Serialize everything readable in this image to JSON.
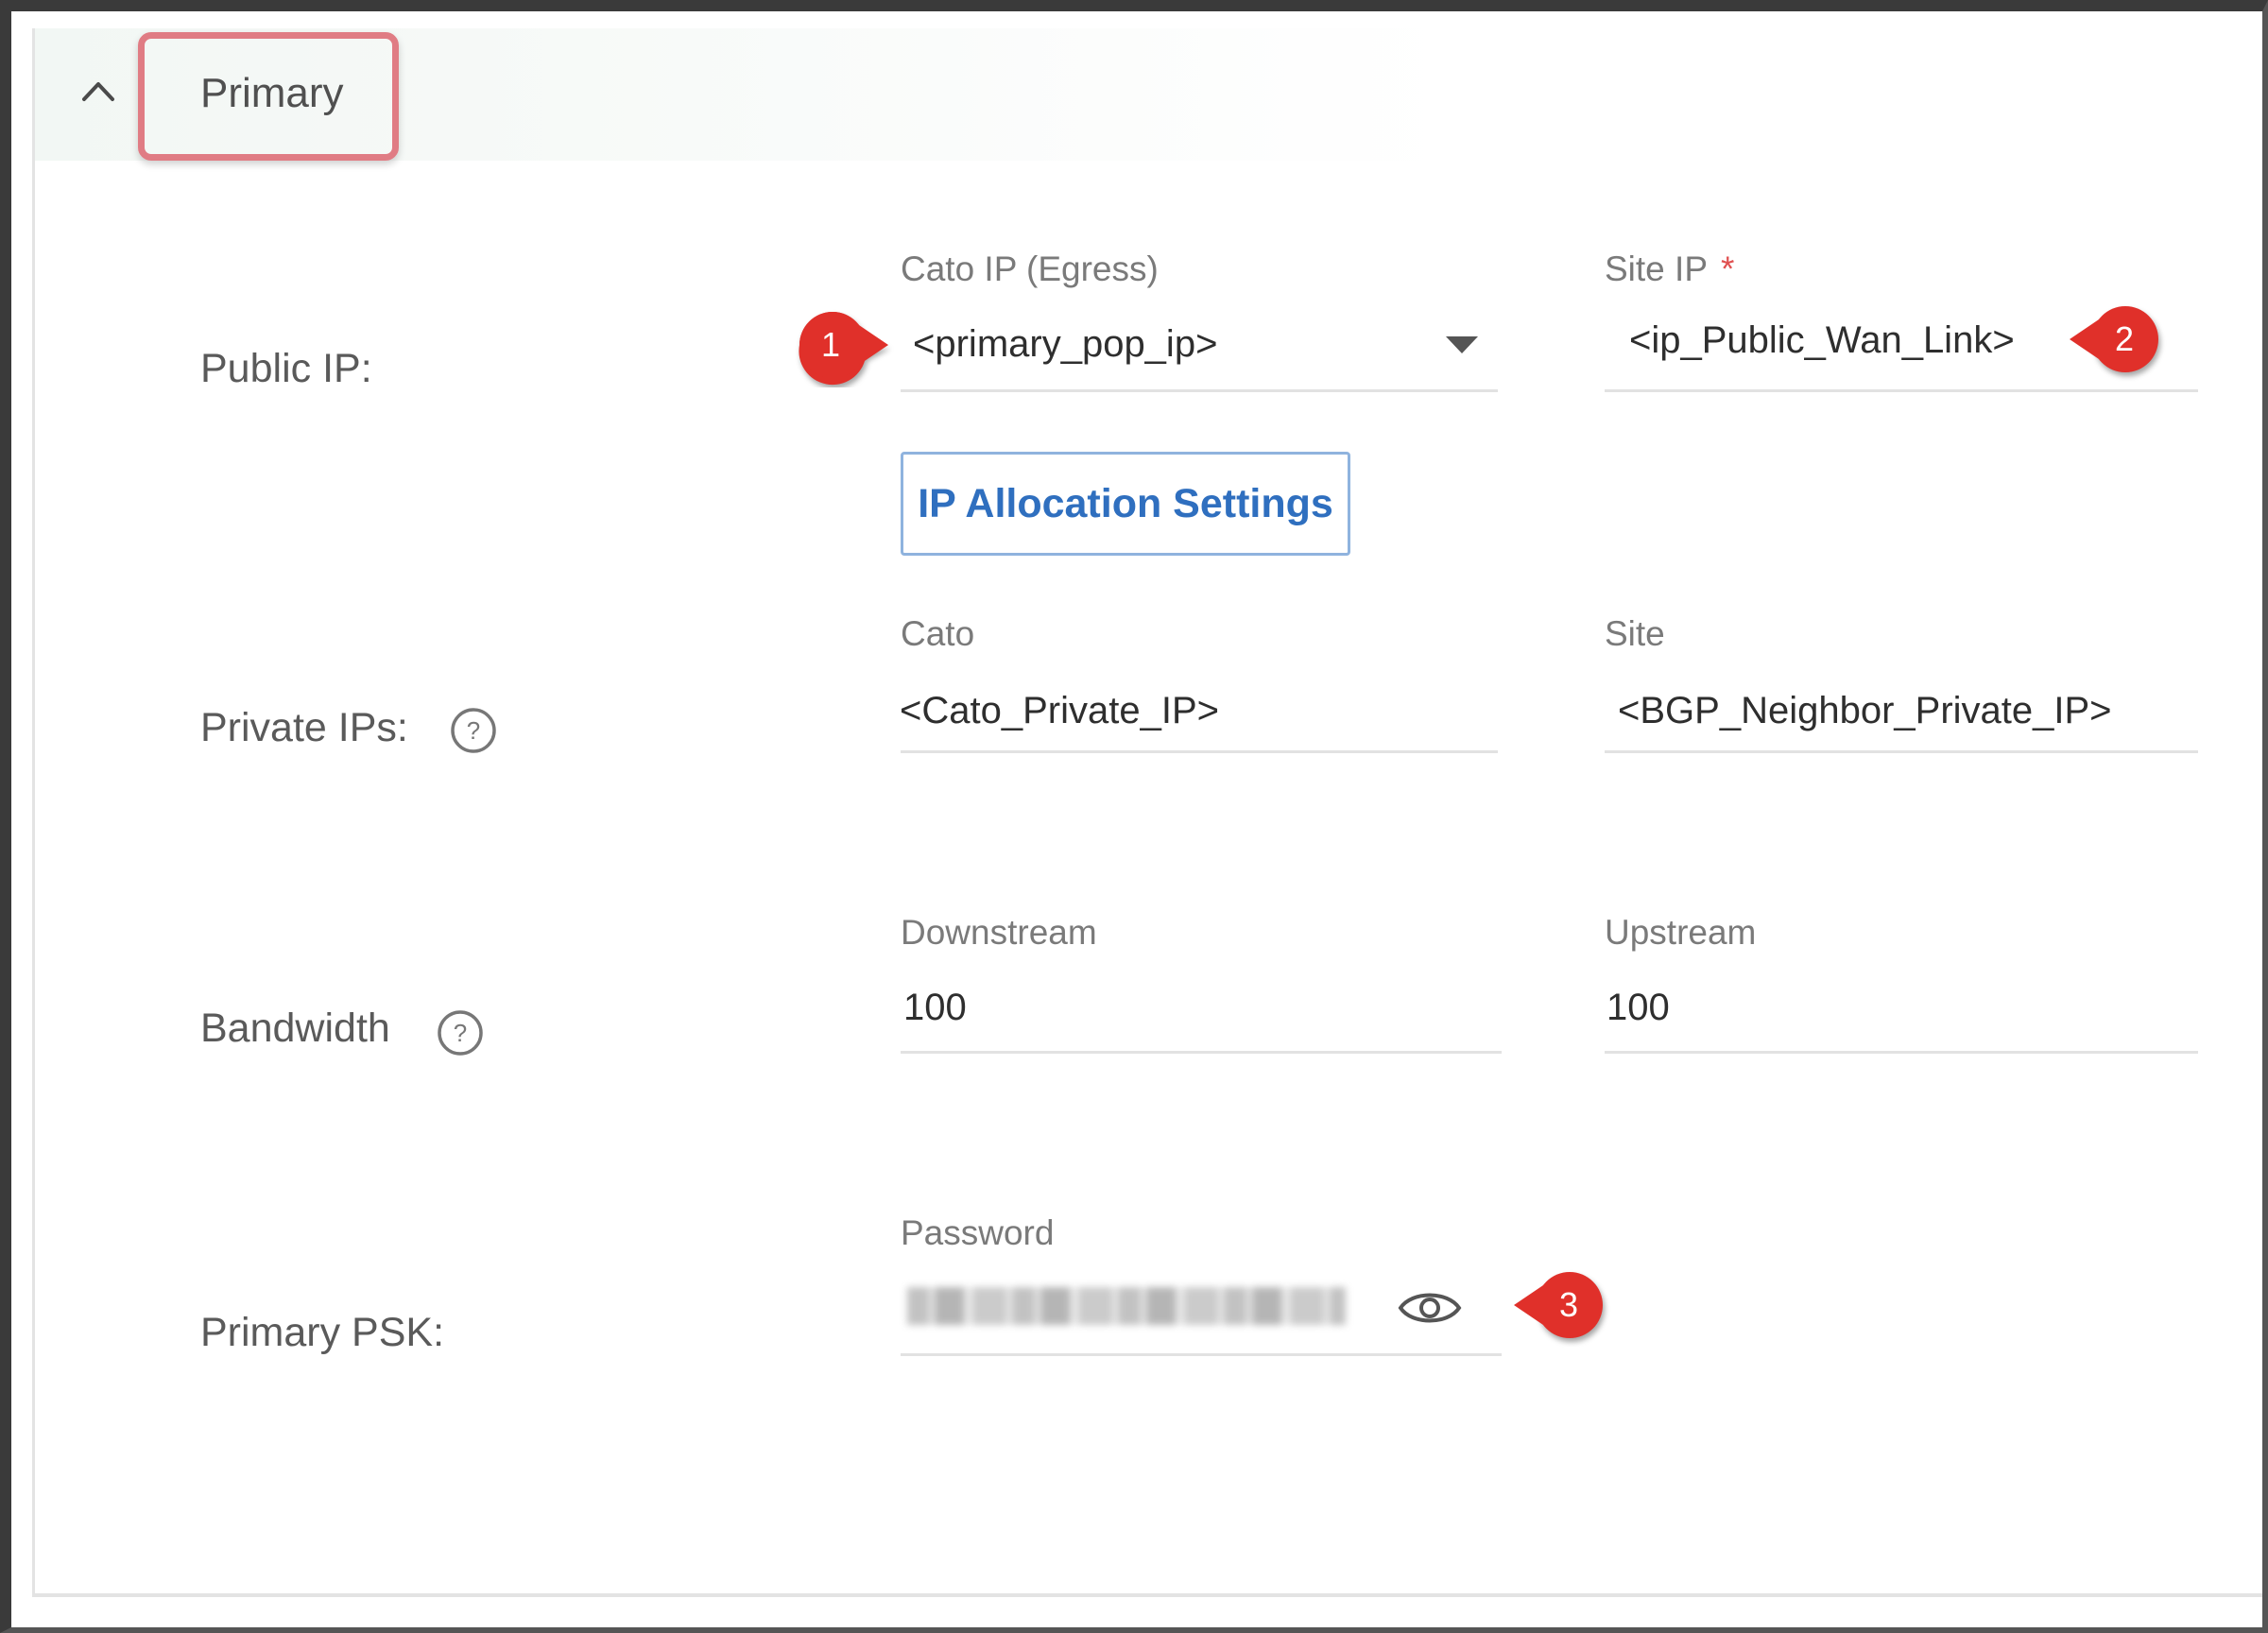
{
  "section": {
    "title": "Primary",
    "collapse_icon": "chevron-up-icon"
  },
  "public_ip": {
    "label": "Public IP:",
    "cato_ip_label": "Cato IP (Egress)",
    "cato_ip_value": "<primary_pop_ip>",
    "site_ip_label": "Site IP",
    "site_ip_required": "*",
    "site_ip_value": "<ip_Public_Wan_Link>",
    "allocation_button": "IP Allocation Settings"
  },
  "private_ips": {
    "label": "Private IPs:",
    "cato_label": "Cato",
    "cato_value": "<Cato_Private_IP>",
    "site_label": "Site",
    "site_value": "<BGP_Neighbor_Private_IP>"
  },
  "bandwidth": {
    "label": "Bandwidth",
    "downstream_label": "Downstream",
    "downstream_value": "100",
    "upstream_label": "Upstream",
    "upstream_value": "100"
  },
  "psk": {
    "label": "Primary PSK:",
    "password_label": "Password",
    "reveal_icon": "eye-icon"
  },
  "annotations": {
    "marker_1": "1",
    "marker_2": "2",
    "marker_3": "3",
    "marker_color": "#e0302a",
    "highlight_color": "#e07c84"
  },
  "colors": {
    "button_text": "#2f6fbf",
    "button_border": "#8fb3de",
    "required": "#e05050"
  }
}
